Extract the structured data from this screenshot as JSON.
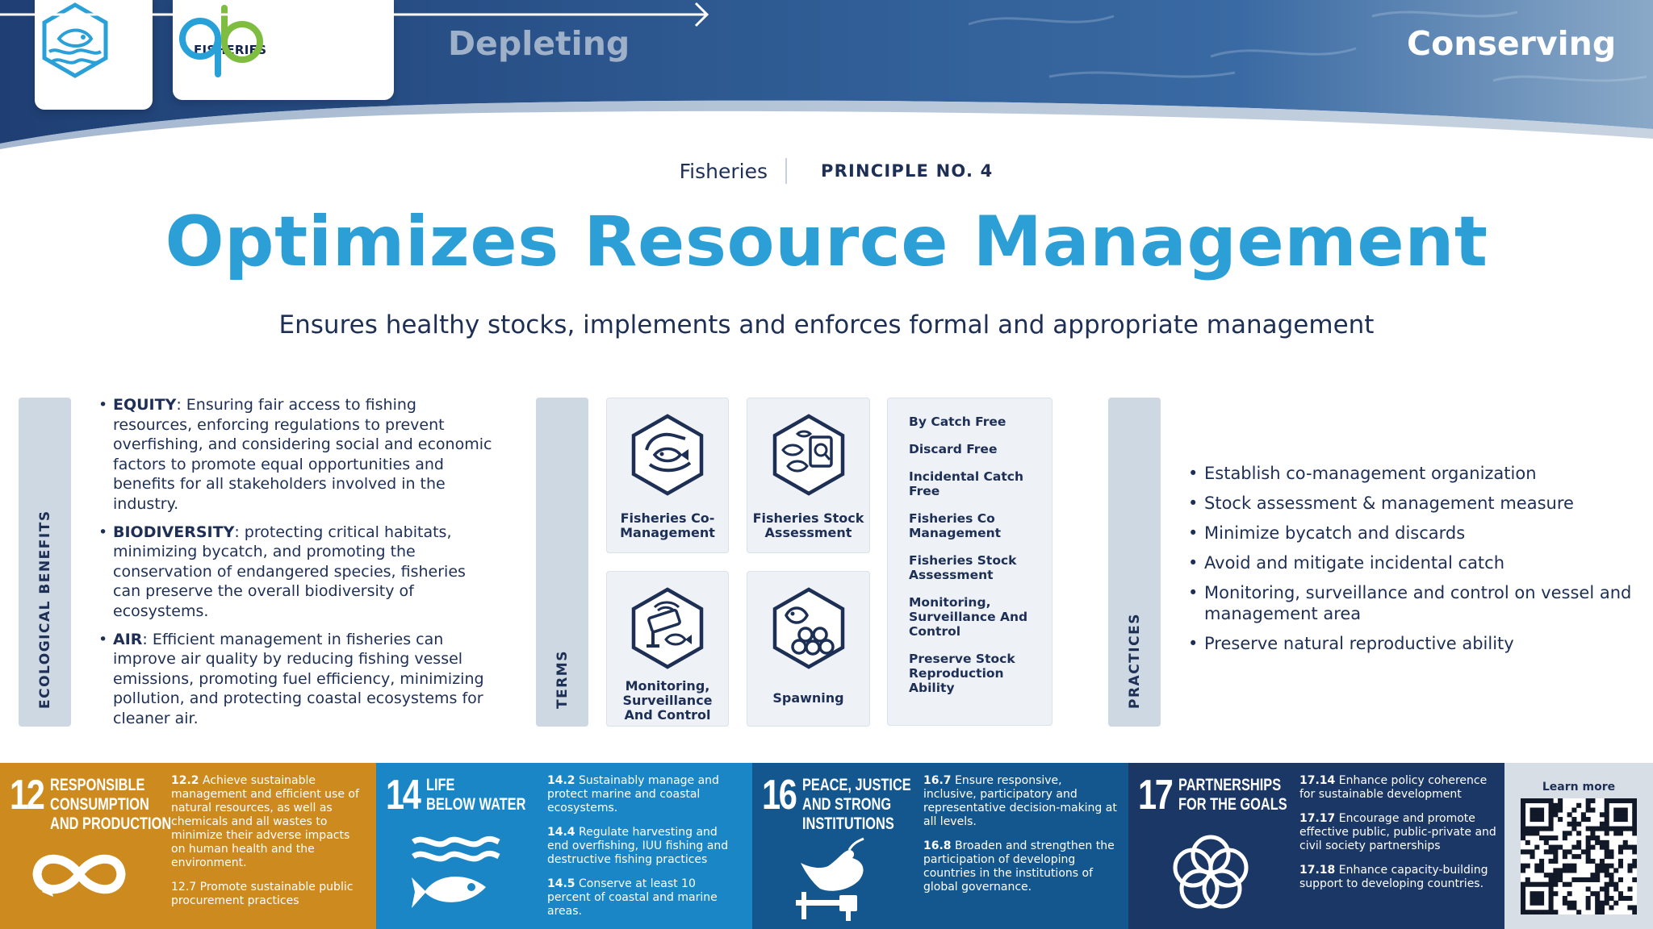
{
  "header": {
    "logo_tag": "FISHERIES",
    "from_label": "Depleting",
    "to_label": "Conserving"
  },
  "meta": {
    "category": "Fisheries",
    "principle": "PRINCIPLE NO. 4"
  },
  "title": "Optimizes Resource Management",
  "subtitle": "Ensures healthy stocks, implements and enforces formal and appropriate management",
  "ecological": {
    "tab_label": "ECOLOGICAL BENEFITS",
    "items": [
      {
        "term": "EQUITY",
        "text": ": Ensuring fair access to fishing resources, enforcing regulations to prevent overfishing, and considering social and economic factors to promote equal opportunities and benefits for all stakeholders involved in the industry."
      },
      {
        "term": "BIODIVERSITY",
        "text": ": protecting critical habitats, minimizing bycatch, and promoting the conservation of endangered species, fisheries can preserve the overall biodiversity of ecosystems."
      },
      {
        "term": "AIR",
        "text": ": Efficient management in fisheries can improve air quality by reducing fishing vessel emissions, promoting fuel efficiency, minimizing pollution, and protecting coastal ecosystems for cleaner air."
      }
    ]
  },
  "terms": {
    "tab_label": "TERMS",
    "cards": [
      {
        "label": "Fisheries Co-Management",
        "icon": "hand-fish-icon"
      },
      {
        "label": "Fisheries Stock Assessment",
        "icon": "fish-survey-icon"
      },
      {
        "label": "Monitoring, Surveillance And Control",
        "icon": "camera-fish-icon"
      },
      {
        "label": "Spawning",
        "icon": "fish-eggs-icon"
      }
    ],
    "list": [
      "By Catch Free",
      "Discard Free",
      "Incidental Catch Free",
      "Fisheries Co Management",
      "Fisheries Stock Assessment",
      "Monitoring, Surveillance And Control",
      "Preserve Stock Reproduction Ability"
    ]
  },
  "practices": {
    "tab_label": "PRACTICES",
    "items": [
      "Establish co-management organization",
      "Stock assessment & management measure",
      "Minimize bycatch and discards",
      "Avoid and mitigate incidental catch",
      "Monitoring, surveillance and control on vessel and management area",
      "Preserve natural reproductive ability"
    ]
  },
  "sdgs": [
    {
      "number": "12",
      "title_lines": [
        "RESPONSIBLE",
        "CONSUMPTION",
        "AND PRODUCTION"
      ],
      "color": "#cd8b1f",
      "icon": "infinity-icon",
      "targets": [
        {
          "code": "12.2",
          "text": " Achieve sustainable management and efficient use of natural resources, as well as chemicals and all wastes to minimize their adverse impacts on human health and the environment."
        },
        {
          "code": "",
          "text": "12.7 Promote sustainable public procurement practices"
        }
      ]
    },
    {
      "number": "14",
      "title_lines": [
        "LIFE",
        "BELOW WATER"
      ],
      "color": "#1a86c5",
      "icon": "fish-waves-icon",
      "targets": [
        {
          "code": "14.2",
          "text": " Sustainably manage and protect marine and coastal ecosystems."
        },
        {
          "code": "14.4",
          "text": " Regulate harvesting and end overfishing, IUU fishing and destructive fishing practices"
        },
        {
          "code": "14.5",
          "text": " Conserve at least 10 percent of coastal and marine areas."
        }
      ]
    },
    {
      "number": "16",
      "title_lines": [
        "PEACE, JUSTICE",
        "AND STRONG",
        "INSTITUTIONS"
      ],
      "color": "#14578f",
      "icon": "dove-gavel-icon",
      "targets": [
        {
          "code": "16.7",
          "text": " Ensure responsive, inclusive, participatory and representative decision-making at all levels."
        },
        {
          "code": "16.8",
          "text": " Broaden and strengthen the participation of developing countries in the institutions of global governance."
        }
      ]
    },
    {
      "number": "17",
      "title_lines": [
        "PARTNERSHIPS",
        "FOR THE GOALS"
      ],
      "color": "#1b3765",
      "icon": "rings-icon",
      "targets": [
        {
          "code": "17.14",
          "text": " Enhance policy coherence for sustainable development"
        },
        {
          "code": "17.17",
          "text": " Encourage and promote effective public, public-private and civil society partnerships"
        },
        {
          "code": "17.18",
          "text": " Enhance capacity-building support to developing countries."
        }
      ]
    }
  ],
  "learn_more": "Learn more",
  "colors": {
    "accent": "#2c9fd6",
    "navy": "#1e2f55",
    "panel": "#eef2f6",
    "tab": "#cdd8e2"
  }
}
